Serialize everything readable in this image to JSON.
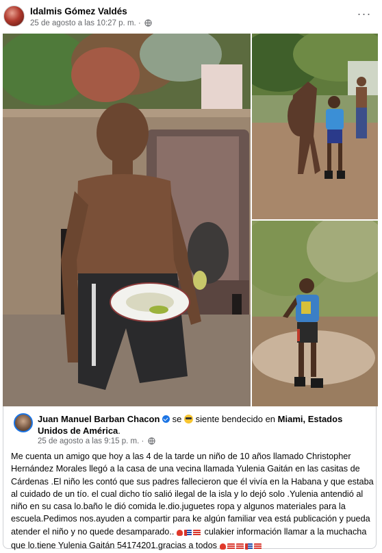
{
  "post": {
    "author": "Idalmis Gómez Valdés",
    "timestamp": "25 de agosto a las 10:27 p. m. ·",
    "privacy_icon": "globe-icon",
    "more_icon": "more-options-icon",
    "more_label": "···"
  },
  "photos": [
    {
      "name": "photo-boy-seated-with-plate"
    },
    {
      "name": "photo-boy-with-horse"
    },
    {
      "name": "photo-boy-in-yard"
    }
  ],
  "shared_post": {
    "author": "Juan Manuel Barban Chacon",
    "feeling_prefix": "se",
    "feeling_text": "siente bendecido en",
    "location": "Miami, Estados Unidos de América",
    "location_suffix": ".",
    "timestamp": "25 de agosto a las 9:15 p. m. ·",
    "text_part1": "Me cuenta un amigo que hoy a las 4 de la tarde un niño de 10 años llamado Christopher Hernández Morales llegó a la casa de una vecina llamada Yulenia Gaitán en las casitas de Cárdenas .El niño les contó que sus padres fallecieron que él vivía en la Habana y que estaba al cuidado de un tío. el cual dicho tío salió ilegal de la isla y lo dejó solo .Yulenia antendió al niño en su casa lo.baño le dió comida  le.dio.juguetes ropa y algunos materiales para la escuela.Pedimos nos.ayuden a compartir para ke algún familiar vea está publicación y pueda atender el niño y no quede desamparado..",
    "text_part2": "culakier información llamar a la muchacha que lo.tiene Yulenia  Gaitán 54174201.gracias a todos",
    "accent_color": "#1b74e4",
    "meta_color": "#65676b"
  }
}
